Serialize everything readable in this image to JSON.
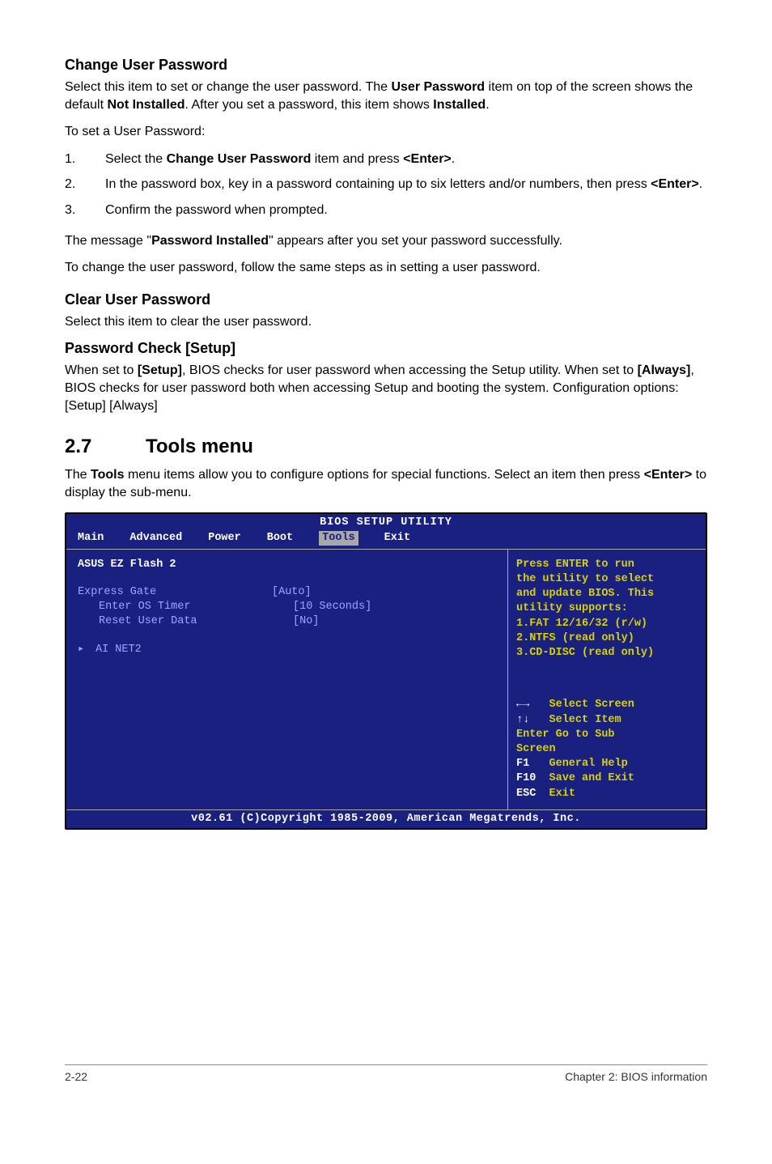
{
  "sec1": {
    "title": "Change User Password",
    "p1_a": "Select this item to set or change the user password. The ",
    "p1_b": "User Password",
    "p1_c": " item on top of the screen shows the default ",
    "p1_d": "Not Installed",
    "p1_e": ". After you set a password, this item shows ",
    "p1_f": "Installed",
    "p1_g": ".",
    "p2": "To set a User Password:",
    "steps": {
      "n1": "1.",
      "s1_a": "Select the ",
      "s1_b": "Change User Password",
      "s1_c": " item and press ",
      "s1_d": "<Enter>",
      "s1_e": ".",
      "n2": "2.",
      "s2_a": "In the password box, key in a password containing up to six letters and/or numbers, then press ",
      "s2_b": "<Enter>",
      "s2_c": ".",
      "n3": "3.",
      "s3": "Confirm the password when prompted."
    },
    "p3_a": "The message \"",
    "p3_b": "Password Installed",
    "p3_c": "\" appears after you set your password successfully.",
    "p4": "To change the user password, follow the same steps as in setting a user password."
  },
  "sec2": {
    "title": "Clear User Password",
    "p1": "Select this item to clear the user password."
  },
  "sec3": {
    "title": "Password Check [Setup]",
    "p1_a": "When set to ",
    "p1_b": "[Setup]",
    "p1_c": ", BIOS checks for user password when accessing the Setup utility. When set to ",
    "p1_d": "[Always]",
    "p1_e": ", BIOS checks for user password both when accessing Setup and booting the system. Configuration options: [Setup] [Always]"
  },
  "sec4": {
    "num": "2.7",
    "title": "Tools menu",
    "p1_a": "The ",
    "p1_b": "Tools",
    "p1_c": " menu items allow you to configure options for special functions. Select an item then press ",
    "p1_d": "<Enter>",
    "p1_e": " to display the sub-menu."
  },
  "bios": {
    "title": "BIOS SETUP UTILITY",
    "tabs": {
      "main": "Main",
      "advanced": "Advanced",
      "power": "Power",
      "boot": "Boot",
      "tools": "Tools",
      "exit": "Exit"
    },
    "left": {
      "ezflash": "ASUS EZ Flash 2",
      "express_gate": "Express Gate",
      "express_gate_val": "[Auto]",
      "enter_os": "Enter OS Timer",
      "enter_os_val": "[10 Seconds]",
      "reset_user": "Reset User Data",
      "reset_user_val": "[No]",
      "ai_net2": "AI NET2",
      "arrow": "▸"
    },
    "right": {
      "help1": "Press ENTER to run",
      "help2": "the utility to select",
      "help3": "and update BIOS. This",
      "help4": "utility supports:",
      "help5": "1.FAT 12/16/32 (r/w)",
      "help6": "2.NTFS (read only)",
      "help7": "3.CD-DISC (read only)",
      "nav_lr_key": "←→",
      "nav_lr": "   Select Screen",
      "nav_ud_key": "↑↓",
      "nav_ud": "   Select Item",
      "nav_enter": "Enter Go to Sub",
      "nav_enter2": "Screen",
      "nav_f1_key": "F1",
      "nav_f1": "   General Help",
      "nav_f10_key": "F10",
      "nav_f10": "  Save and Exit",
      "nav_esc_key": "ESC",
      "nav_esc": "  Exit"
    },
    "footer": "v02.61 (C)Copyright 1985-2009, American Megatrends, Inc."
  },
  "footer": {
    "left": "2-22",
    "right": "Chapter 2: BIOS information"
  }
}
